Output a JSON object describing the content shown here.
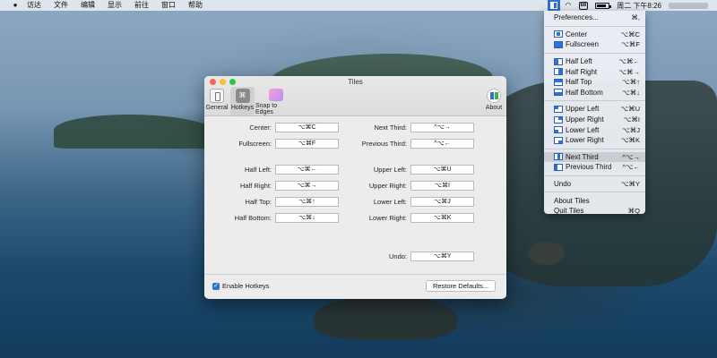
{
  "menubar": {
    "apple_icon": "apple-icon",
    "items": [
      "访达",
      "文件",
      "编辑",
      "显示",
      "前往",
      "窗口",
      "帮助"
    ],
    "badge": "88",
    "battery_level_percent": 85,
    "clock": "周二 下午8:26"
  },
  "dropdown": {
    "groups": [
      [
        {
          "label": "Preferences...",
          "shortcut": "⌘,"
        }
      ],
      [
        {
          "label": "Center",
          "shortcut": "⌥⌘C",
          "icon": "center"
        },
        {
          "label": "Fullscreen",
          "shortcut": "⌥⌘F",
          "icon": "full"
        }
      ],
      [
        {
          "label": "Half Left",
          "shortcut": "⌥⌘←",
          "icon": "left"
        },
        {
          "label": "Half Right",
          "shortcut": "⌥⌘→",
          "icon": "right"
        },
        {
          "label": "Half Top",
          "shortcut": "⌥⌘↑",
          "icon": "top"
        },
        {
          "label": "Half Bottom",
          "shortcut": "⌥⌘↓",
          "icon": "bottom"
        }
      ],
      [
        {
          "label": "Upper Left",
          "shortcut": "⌥⌘U",
          "icon": "ul"
        },
        {
          "label": "Upper Right",
          "shortcut": "⌥⌘I",
          "icon": "ur"
        },
        {
          "label": "Lower Left",
          "shortcut": "⌥⌘J",
          "icon": "ll"
        },
        {
          "label": "Lower Right",
          "shortcut": "⌥⌘K",
          "icon": "lr"
        }
      ],
      [
        {
          "label": "Next Third",
          "shortcut": "^⌥→",
          "icon": "nt",
          "highlighted": true
        },
        {
          "label": "Previous Third",
          "shortcut": "^⌥←",
          "icon": "pt"
        }
      ],
      [
        {
          "label": "Undo",
          "shortcut": "⌥⌘Y"
        }
      ],
      [
        {
          "label": "About Tiles",
          "shortcut": ""
        },
        {
          "label": "Quit Tiles",
          "shortcut": "⌘Q"
        }
      ]
    ]
  },
  "window": {
    "title": "Tiles",
    "toolbar": {
      "general": "General",
      "hotkeys": "Hotkeys",
      "hotkeys_glyph": "⌘",
      "snap": "Snap to Edges",
      "about": "About"
    },
    "left_rows": [
      {
        "label": "Center:",
        "value": "⌥⌘C"
      },
      {
        "label": "Fullscreen:",
        "value": "⌥⌘F"
      },
      {
        "label": "Half Left:",
        "value": "⌥⌘←"
      },
      {
        "label": "Half Right:",
        "value": "⌥⌘→"
      },
      {
        "label": "Half Top:",
        "value": "⌥⌘↑"
      },
      {
        "label": "Half Bottom:",
        "value": "⌥⌘↓"
      }
    ],
    "right_rows": [
      {
        "label": "Next Third:",
        "value": "^⌥→"
      },
      {
        "label": "Previous Third:",
        "value": "^⌥←"
      },
      {
        "label": "Upper Left:",
        "value": "⌥⌘U"
      },
      {
        "label": "Upper Right:",
        "value": "⌥⌘I"
      },
      {
        "label": "Lower Left:",
        "value": "⌥⌘J"
      },
      {
        "label": "Lower Right:",
        "value": "⌥⌘K"
      },
      {
        "label": "Undo:",
        "value": "⌥⌘Y"
      }
    ],
    "enable_hotkeys": {
      "label": "Enable Hotkeys",
      "checked": true,
      "check_glyph": "✓"
    },
    "restore_button": "Restore Defaults..."
  },
  "colors": {
    "accent": "#2e72d8",
    "close": "#fe5f57",
    "minimize": "#febc2e",
    "maximize": "#28c840"
  }
}
